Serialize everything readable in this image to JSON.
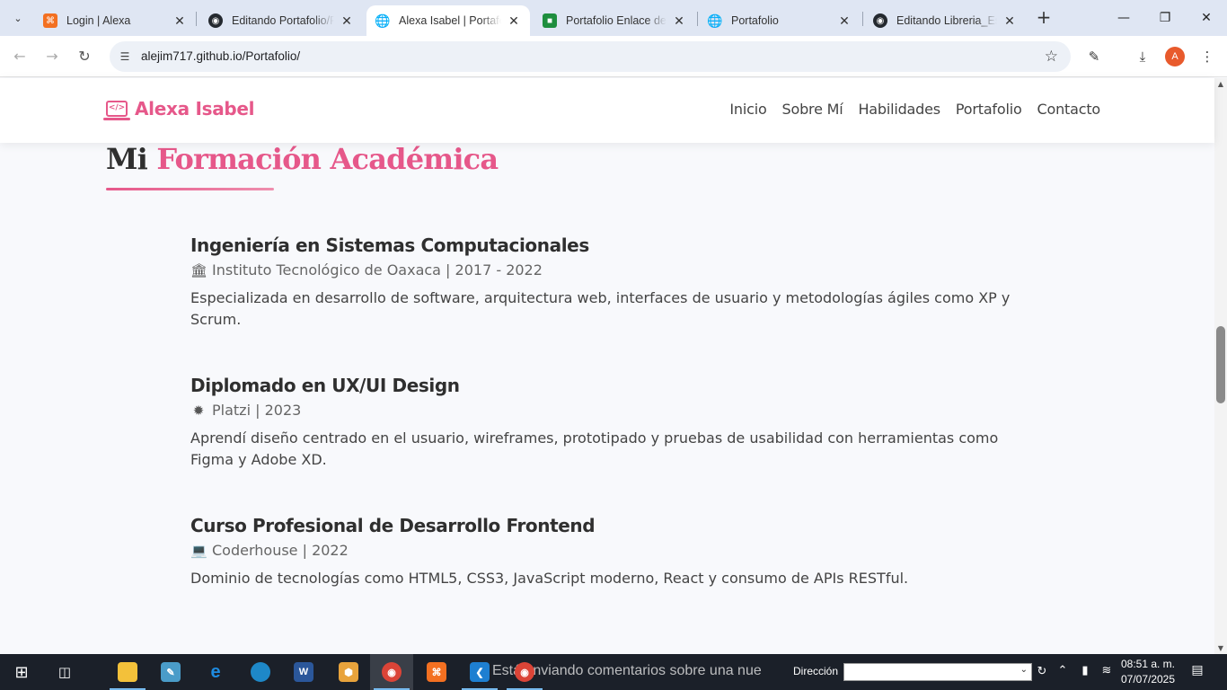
{
  "browser": {
    "tabs": [
      {
        "title": "Login | Alexa",
        "favicon": "xampp-icon",
        "color": "#f37021",
        "active": false
      },
      {
        "title": "Editando Portafolio/R",
        "favicon": "github-icon",
        "color": "#24292f",
        "active": false
      },
      {
        "title": "Alexa Isabel | Portafol",
        "favicon": "globe-icon",
        "color": "#444444",
        "active": true
      },
      {
        "title": "Portafolio Enlace de r",
        "favicon": "classroom-icon",
        "color": "#1e8e3e",
        "active": false
      },
      {
        "title": "Portafolio",
        "favicon": "globe-icon",
        "color": "#444444",
        "active": false
      },
      {
        "title": "Editando Libreria_Esp",
        "favicon": "github-icon",
        "color": "#24292f",
        "active": false
      }
    ],
    "url": "alejim717.github.io/Portafolio/",
    "profile_initial": "A"
  },
  "site": {
    "brand": "Alexa Isabel",
    "brand_icon": "</>",
    "nav": [
      "Inicio",
      "Sobre Mí",
      "Habilidades",
      "Portafolio",
      "Contacto"
    ],
    "accent_color": "#e6588a"
  },
  "section": {
    "title_prefix": "Mi",
    "title_accent": "Formación Académica",
    "items": [
      {
        "title": "Ingeniería en Sistemas Computacionales",
        "icon": "university-icon",
        "meta": "Instituto Tecnológico de Oaxaca | 2017 - 2022",
        "description": "Especializada en desarrollo de software, arquitectura web, interfaces de usuario y metodologías ágiles como XP y Scrum."
      },
      {
        "title": "Diplomado en UX/UI Design",
        "icon": "certificate-icon",
        "meta": "Platzi | 2023",
        "description": "Aprendí diseño centrado en el usuario, wireframes, prototipado y pruebas de usabilidad con herramientas como Figma y Adobe XD."
      },
      {
        "title": "Curso Profesional de Desarrollo Frontend",
        "icon": "laptop-code-icon",
        "meta": "Coderhouse | 2022",
        "description": "Dominio de tecnologías como HTML5, CSS3, JavaScript moderno, React y consumo de APIs RESTful."
      }
    ]
  },
  "taskbar": {
    "ticker": "Está enviando comentarios sobre una nue",
    "address_label": "Dirección",
    "address_value": "",
    "time": "08:51 a. m.",
    "date": "07/07/2025"
  }
}
